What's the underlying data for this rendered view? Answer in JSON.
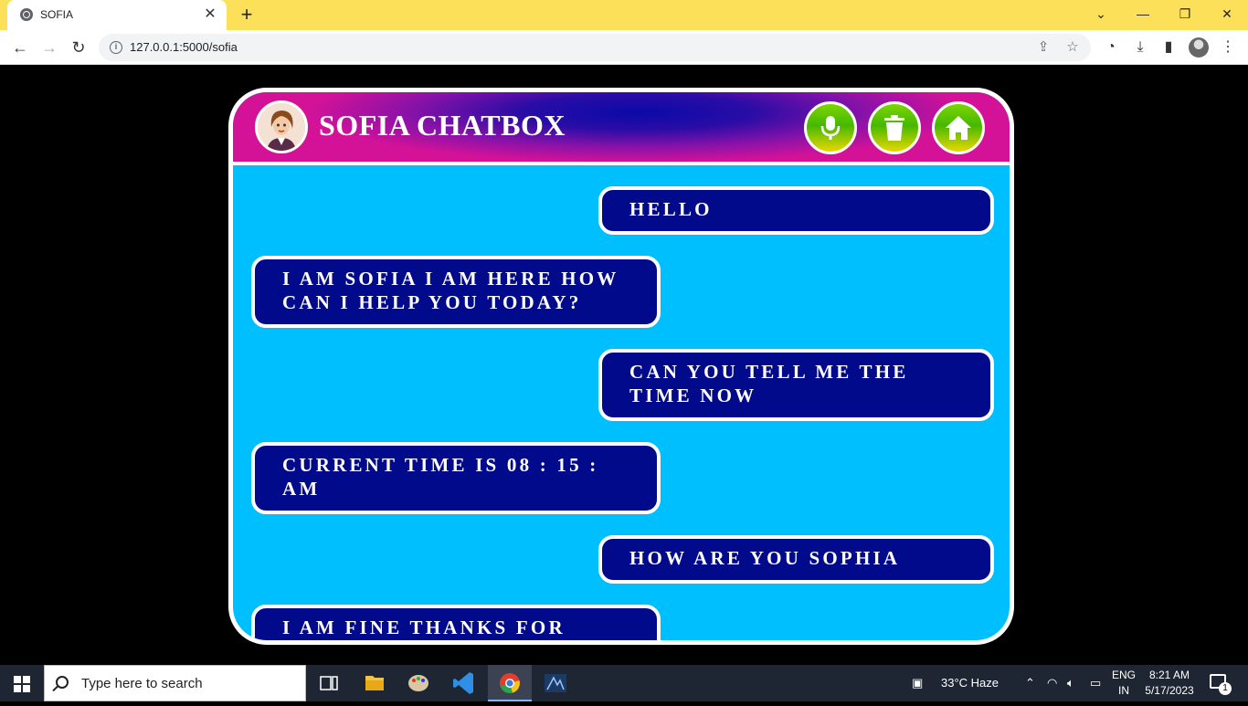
{
  "browser": {
    "tab_title": "SOFIA",
    "tab_close": "✕",
    "new_tab": "+",
    "url": "127.0.0.1:5000/sofia",
    "info_glyph": "i",
    "window_controls": {
      "dropdown": "⌄",
      "minimize": "—",
      "restore": "❐",
      "close": "✕"
    },
    "nav": {
      "back": "←",
      "forward": "→",
      "reload": "↻"
    },
    "toolbar_icons": [
      "share-icon",
      "star-icon",
      "extension-icon",
      "download-icon",
      "sidebar-icon",
      "profile-avatar",
      "menu-icon"
    ]
  },
  "chat": {
    "title": "SOFIA CHATBOX",
    "header_buttons": [
      "microphone-icon",
      "trash-icon",
      "home-icon"
    ],
    "colors": {
      "panel": "#00bfff",
      "bubble": "#020a8c",
      "button_green": "#46b800",
      "button_yellow": "#e9d800"
    },
    "messages": [
      {
        "sender": "user",
        "text": "HELLO"
      },
      {
        "sender": "bot",
        "text": "I AM SOFIA I AM HERE HOW CAN I HELP YOU TODAY?"
      },
      {
        "sender": "user",
        "text": "CAN YOU TELL ME THE TIME NOW"
      },
      {
        "sender": "bot",
        "text": "CURRENT TIME IS 08 : 15 : AM"
      },
      {
        "sender": "user",
        "text": "HOW ARE YOU SOPHIA"
      },
      {
        "sender": "bot",
        "text": "I AM FINE THANKS FOR"
      }
    ]
  },
  "taskbar": {
    "search_placeholder": "Type here to search",
    "weather": "33°C  Haze",
    "language_line1": "ENG",
    "language_line2": "IN",
    "time": "8:21 AM",
    "date": "5/17/2023",
    "notification_count": "1",
    "apps": [
      "task-view-icon",
      "file-explorer-icon",
      "paint-icon",
      "vscode-icon",
      "chrome-icon",
      "python-icon"
    ]
  }
}
